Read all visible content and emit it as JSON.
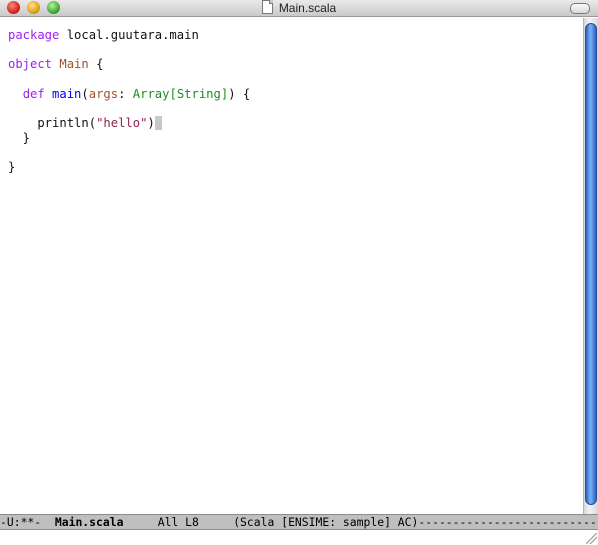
{
  "window": {
    "title": "Main.scala"
  },
  "editor": {
    "lines": [
      [
        {
          "t": "package",
          "c": "kw"
        },
        {
          "t": " local.guutara.main",
          "c": ""
        }
      ],
      [],
      [
        {
          "t": "object",
          "c": "kw"
        },
        {
          "t": " ",
          "c": ""
        },
        {
          "t": "Main",
          "c": "var"
        },
        {
          "t": " {",
          "c": ""
        }
      ],
      [],
      [
        {
          "t": "  ",
          "c": ""
        },
        {
          "t": "def",
          "c": "kw"
        },
        {
          "t": " ",
          "c": ""
        },
        {
          "t": "main",
          "c": "fn"
        },
        {
          "t": "(",
          "c": ""
        },
        {
          "t": "args",
          "c": "var"
        },
        {
          "t": ": ",
          "c": ""
        },
        {
          "t": "Array[String]",
          "c": "type"
        },
        {
          "t": ") {",
          "c": ""
        }
      ],
      [],
      [
        {
          "t": "    println(",
          "c": ""
        },
        {
          "t": "\"hello\"",
          "c": "str"
        },
        {
          "t": ")",
          "c": ""
        },
        {
          "t": " ",
          "c": "cursor"
        }
      ],
      [
        {
          "t": "  }",
          "c": ""
        }
      ],
      [],
      [
        {
          "t": "}",
          "c": ""
        }
      ]
    ]
  },
  "modeline": {
    "status": "-U:**-",
    "buffer": "Main.scala",
    "position": "All L8",
    "mode": "(Scala [ENSIME: sample] AC)",
    "fill": "------------------------------------------------------------"
  },
  "minibuffer": {
    "text": ""
  }
}
